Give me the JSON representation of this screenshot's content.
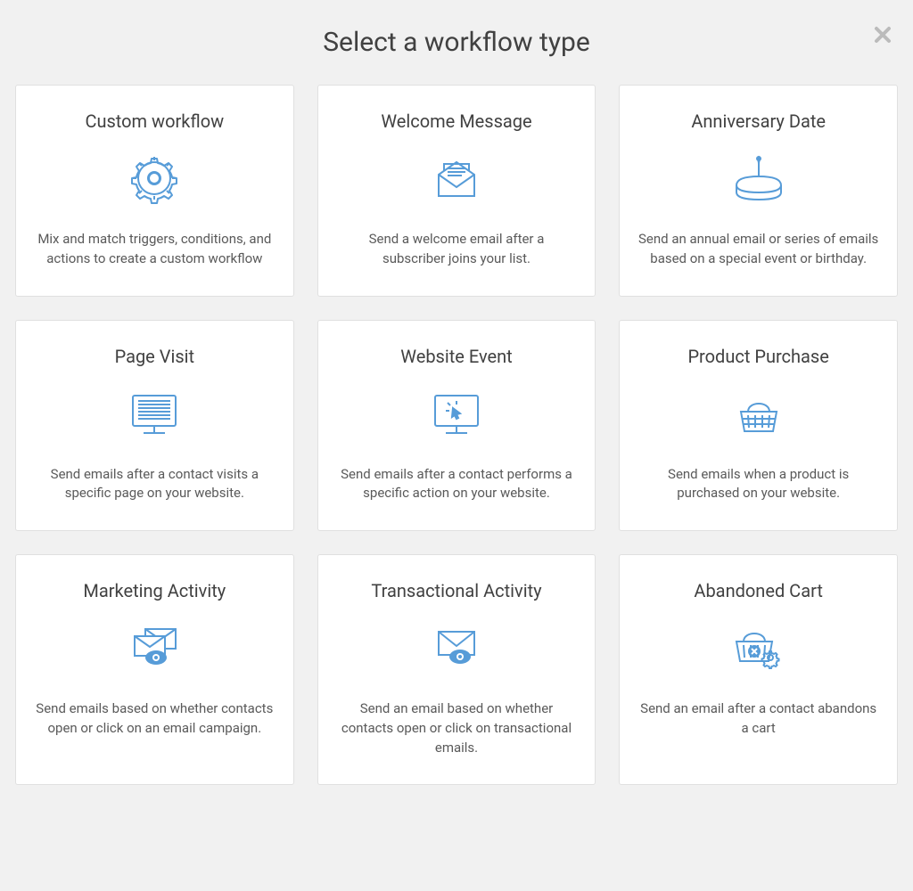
{
  "header": {
    "title": "Select a workflow type"
  },
  "cards": [
    {
      "title": "Custom workflow",
      "description": "Mix and match triggers, conditions, and actions to create a custom workflow",
      "icon": "gear"
    },
    {
      "title": "Welcome Message",
      "description": "Send a welcome email after a subscriber joins your list.",
      "icon": "envelope-open"
    },
    {
      "title": "Anniversary Date",
      "description": "Send an annual email or series of emails based on a special event or birthday.",
      "icon": "cake"
    },
    {
      "title": "Page Visit",
      "description": "Send emails after a contact visits a specific page on your website.",
      "icon": "monitor-lines"
    },
    {
      "title": "Website Event",
      "description": "Send emails after a contact performs a specific action on your website.",
      "icon": "monitor-click"
    },
    {
      "title": "Product Purchase",
      "description": "Send emails when a product is purchased on your website.",
      "icon": "basket"
    },
    {
      "title": "Marketing Activity",
      "description": "Send emails based on whether contacts open or click on an email campaign.",
      "icon": "envelopes-eye"
    },
    {
      "title": "Transactional Activity",
      "description": "Send an email based on whether contacts open or click on transactional emails.",
      "icon": "envelope-eye"
    },
    {
      "title": "Abandoned Cart",
      "description": "Send an email after a contact abandons a cart",
      "icon": "basket-x-gear"
    }
  ]
}
